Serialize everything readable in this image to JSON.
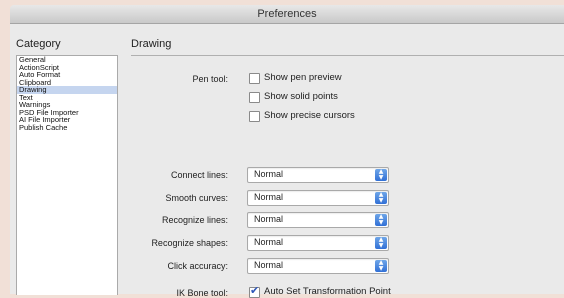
{
  "window": {
    "title": "Preferences"
  },
  "sidebar": {
    "heading": "Category",
    "items": [
      {
        "label": "General"
      },
      {
        "label": "ActionScript"
      },
      {
        "label": "Auto Format"
      },
      {
        "label": "Clipboard"
      },
      {
        "label": "Drawing",
        "selected": true
      },
      {
        "label": "Text"
      },
      {
        "label": "Warnings"
      },
      {
        "label": "PSD File Importer"
      },
      {
        "label": "AI File Importer"
      },
      {
        "label": "Publish Cache"
      }
    ]
  },
  "main": {
    "title": "Drawing",
    "pen_tool": {
      "label": "Pen tool:",
      "options": [
        {
          "label": "Show pen preview",
          "checked": false
        },
        {
          "label": "Show solid points",
          "checked": false
        },
        {
          "label": "Show precise cursors",
          "checked": false
        }
      ]
    },
    "selects": [
      {
        "label": "Connect lines:",
        "value": "Normal"
      },
      {
        "label": "Smooth curves:",
        "value": "Normal"
      },
      {
        "label": "Recognize lines:",
        "value": "Normal"
      },
      {
        "label": "Recognize shapes:",
        "value": "Normal"
      },
      {
        "label": "Click accuracy:",
        "value": "Normal"
      }
    ],
    "ik_bone": {
      "label": "IK Bone tool:",
      "option_label": "Auto Set Transformation Point",
      "checked": true
    }
  },
  "colors": {
    "accent": "#3170d6",
    "selection": "#c5d5ef",
    "background": "#eaeaea"
  }
}
